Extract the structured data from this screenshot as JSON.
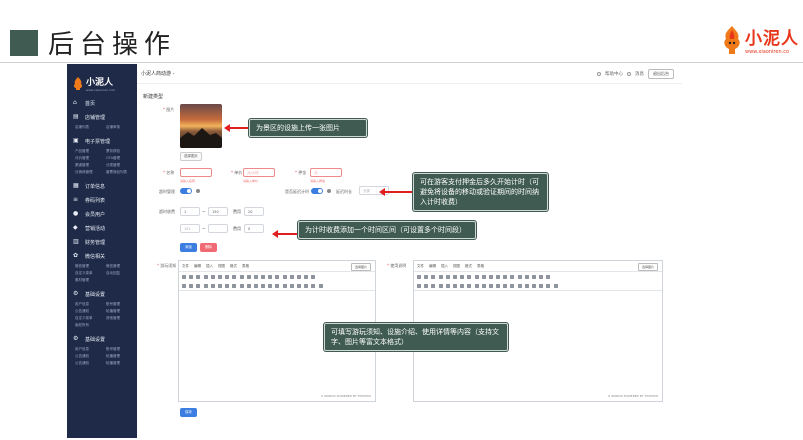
{
  "slide": {
    "title": "后台操作",
    "brand_name": "小泥人",
    "brand_url": "www.xiaoniren.co"
  },
  "sidebar": {
    "logo_name": "小泥人",
    "logo_url": "www.xiaoniren.com",
    "items": [
      {
        "label": "首页",
        "subs": []
      },
      {
        "label": "店铺管理",
        "subs": [
          "店铺列表",
          "店铺审核"
        ]
      },
      {
        "label": "电子票管理",
        "subs": [
          "产品管理",
          "票务核验",
          "评价管理",
          "OTA管理",
          "渠道管理",
          "分类管理",
          "分销商管理",
          "套票商品列表"
        ]
      },
      {
        "label": "订单信息",
        "subs": []
      },
      {
        "label": "券码列表",
        "subs": []
      },
      {
        "label": "会员用户",
        "subs": []
      },
      {
        "label": "营销活动",
        "subs": []
      },
      {
        "label": "财务管理",
        "subs": []
      },
      {
        "label": "微信相关",
        "subs": [
          "微信管理",
          "微信管理",
          "自定义菜单",
          "自动回复",
          "素材管理"
        ]
      },
      {
        "label": "基础设置",
        "subs": [
          "用户信息",
          "账号管理",
          "公告通知",
          "轮播管理",
          "自定义菜单",
          "其他管理",
          "版权所有"
        ]
      },
      {
        "label": "基础设置",
        "subs": [
          "用户信息",
          "账号管理",
          "公告通知",
          "轮播管理",
          "公告通知",
          "轮播管理"
        ]
      }
    ]
  },
  "topbar": {
    "breadcrumb": "小泥人商动游 -",
    "help": "帮助中心",
    "messages": "消息",
    "logout": "退出后台"
  },
  "form": {
    "section_title": "新建类型",
    "image_label": "图片",
    "choose_image": "选择图片",
    "name_label": "名称",
    "name_err": "请输入名称",
    "price_label": "单价",
    "price_placeholder": "元/小时",
    "price_err": "请输入单价",
    "deposit_label": "押金",
    "deposit_placeholder": "元",
    "deposit_err": "请输入押金",
    "timing_label": "超时管理",
    "delay_label": "是否延迟计时",
    "delay_time_label": "延迟时长",
    "delay_placeholder": "分钟",
    "fee_label": "超时收费",
    "row1_from": "1",
    "row1_to": "150",
    "row1_fee_label": "费用",
    "row1_fee": "20",
    "row2_from": "151",
    "row2_to": "",
    "row2_fee_label": "费用",
    "row2_fee": "0",
    "add_btn": "添加",
    "del_btn": "删除",
    "intro_label": "游玩须知",
    "usage_label": "使用说明",
    "editor_menu": [
      "文件",
      "编辑",
      "插入",
      "视图",
      "格式",
      "表格"
    ],
    "editor_select": "选择图片",
    "editor_footer": "0 WORDS POWERED BY TINYMCE",
    "save_btn": "保存"
  },
  "callouts": {
    "upload": "为景区的设施上传一张图片",
    "deposit": "可在游客支付押金后多久开始计时（可避免将设备的移动或验证期间的时间纳入计时收费）",
    "interval": "为计时收费添加一个时间区间（可设置多个时间段）",
    "editor": "可填写游玩须知、设施介绍、使用详情等内容（支持文字、图片等富文本格式）"
  }
}
